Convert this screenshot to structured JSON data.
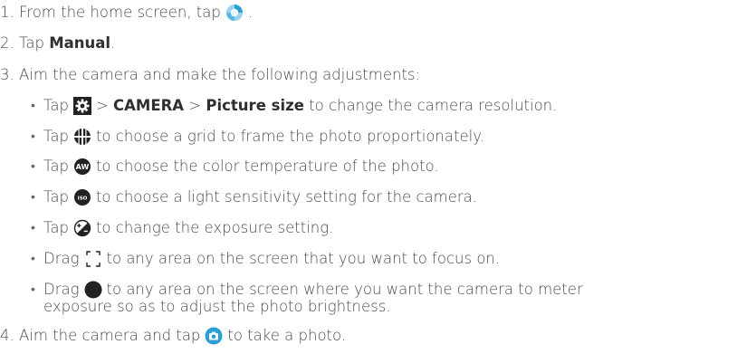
{
  "steps": {
    "s1": {
      "num": "1.",
      "pre": "From the home screen, tap",
      "post": "."
    },
    "s2": {
      "num": "2.",
      "pre": "Tap",
      "bold": "Manual",
      "post": "."
    },
    "s3": {
      "num": "3.",
      "text": "Aim the camera and make the following adjustments:"
    },
    "s4": {
      "num": "4.",
      "pre": "Aim the camera and tap",
      "post": "to take a photo."
    }
  },
  "bullets": {
    "b1": {
      "pre": "Tap",
      "sep1": ">",
      "bold1": "CAMERA",
      "sep2": ">",
      "bold2": "Picture size",
      "post": "to change the camera resolution."
    },
    "b2": {
      "pre": "Tap",
      "post": "to choose a grid to frame the photo proportionately."
    },
    "b3": {
      "pre": "Tap",
      "post": "to choose the color temperature of the photo."
    },
    "b4": {
      "pre": "Tap",
      "post": "to choose a light sensitivity setting for the camera."
    },
    "b5": {
      "pre": "Tap",
      "post": "to change the exposure setting."
    },
    "b6": {
      "pre": "Drag",
      "post": "to any area on the screen that you want to focus on."
    },
    "b7": {
      "pre": "Drag",
      "post": "to any area on the screen where you want the camera to meter",
      "post2": "exposure so as to adjust the photo brightness."
    }
  },
  "icons": {
    "camera_app": "camera-app-icon",
    "settings": "settings-gear-icon",
    "grid": "grid-icon",
    "white_balance": "white-balance-icon",
    "iso": "iso-icon",
    "exposure": "exposure-icon",
    "focus": "focus-frame-icon",
    "metering": "metering-circle-icon",
    "shutter": "shutter-icon"
  },
  "icon_text": {
    "aw": "AW",
    "iso": "ISO"
  },
  "colors": {
    "text": "#4a4a4a",
    "icon_dark": "#222222",
    "camera_blue": "#2a9fd6"
  }
}
